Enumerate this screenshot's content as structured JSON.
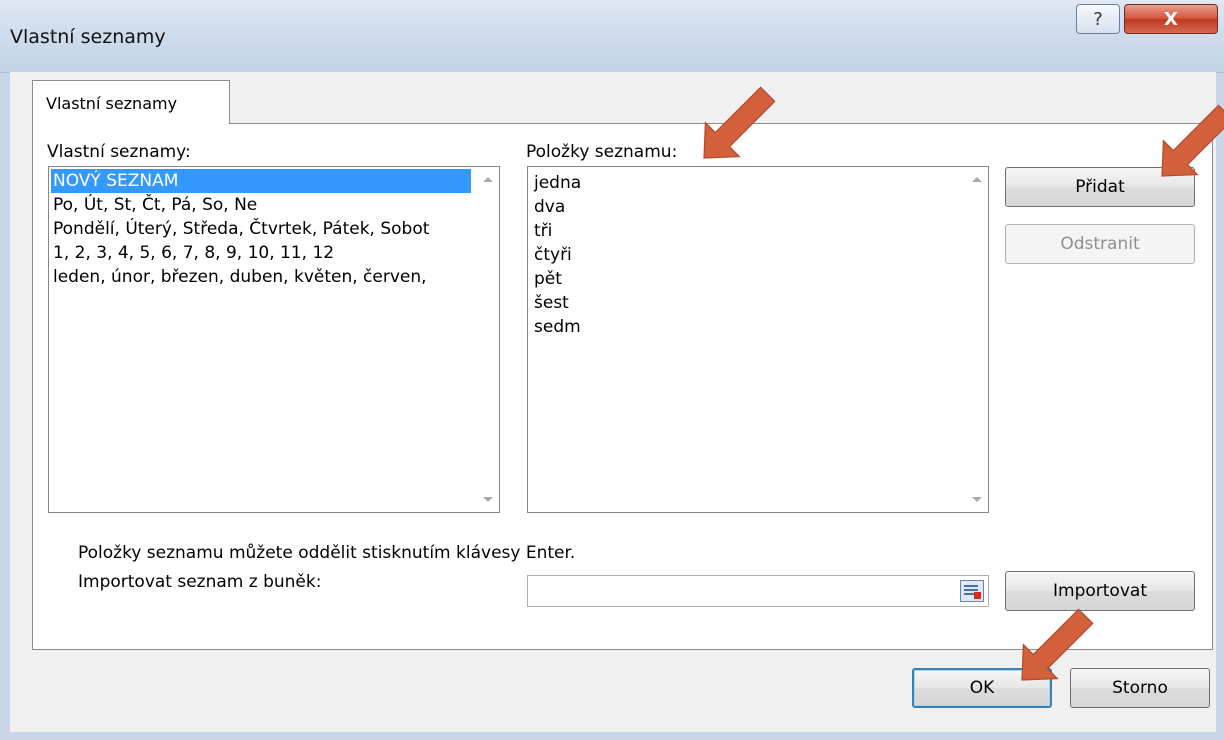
{
  "window": {
    "title": "Vlastní seznamy",
    "help_glyph": "?",
    "close_glyph": "X"
  },
  "tabs": [
    {
      "label": "Vlastní seznamy"
    }
  ],
  "lists_panel": {
    "label": "Vlastní seznamy:",
    "items": [
      "NOVÝ SEZNAM",
      "Po, Út, St, Čt, Pá, So, Ne",
      "Pondělí, Úterý, Středa, Čtvrtek, Pátek, Sobot",
      "1, 2, 3, 4, 5, 6, 7, 8, 9, 10, 11, 12",
      "leden, únor, březen, duben, květen, červen,"
    ],
    "selected_index": 0
  },
  "entries_panel": {
    "label": "Položky seznamu:",
    "items": [
      "jedna",
      "dva",
      "tři",
      "čtyři",
      "pět",
      "šest",
      "sedm"
    ]
  },
  "buttons": {
    "add": "Přidat",
    "remove": "Odstranit",
    "import": "Importovat",
    "ok": "OK",
    "cancel": "Storno"
  },
  "hint_text": "Položky seznamu můžete oddělit stisknutím klávesy Enter.",
  "import_label": "Importovat seznam z buněk:",
  "import_value": "",
  "icons": {
    "refedit": "collapse-dialog-icon",
    "annotation": "arrow-icon"
  },
  "colors": {
    "annotation_arrow": "#d2603a",
    "selection": "#3399ff",
    "close_button": "#c9462e"
  }
}
